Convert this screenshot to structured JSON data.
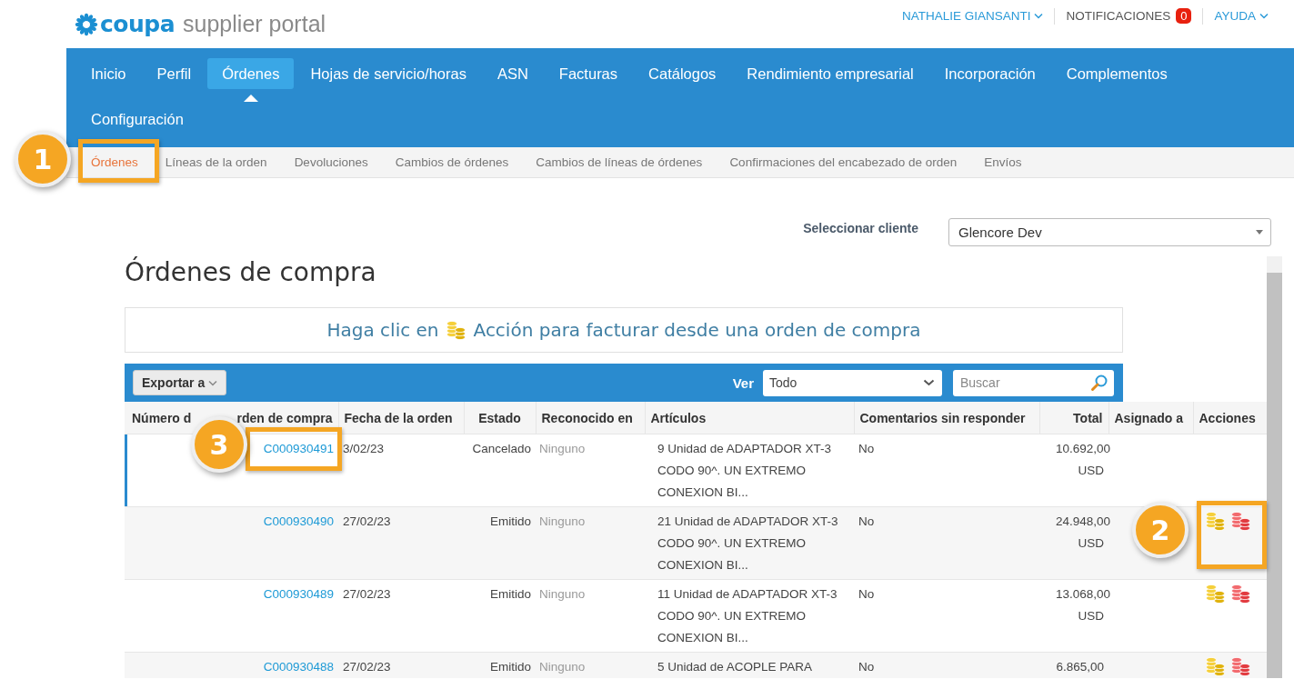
{
  "header": {
    "logo": {
      "brand": "coupa",
      "product": "supplier portal"
    },
    "user": "NATHALIE GIANSANTI",
    "notifications": {
      "label": "NOTIFICACIONES",
      "count": "0"
    },
    "help": "AYUDA"
  },
  "nav": {
    "items": [
      {
        "label": "Inicio",
        "selected": false
      },
      {
        "label": "Perfil",
        "selected": false
      },
      {
        "label": "Órdenes",
        "selected": true
      },
      {
        "label": "Hojas de servicio/horas",
        "selected": false
      },
      {
        "label": "ASN",
        "selected": false
      },
      {
        "label": "Facturas",
        "selected": false
      },
      {
        "label": "Catálogos",
        "selected": false
      },
      {
        "label": "Rendimiento empresarial",
        "selected": false
      },
      {
        "label": "Incorporación",
        "selected": false
      },
      {
        "label": "Complementos",
        "selected": false
      },
      {
        "label": "Configuración",
        "selected": false
      }
    ]
  },
  "subnav": {
    "items": [
      {
        "label": "Órdenes",
        "selected": true
      },
      {
        "label": "Líneas de la orden",
        "selected": false
      },
      {
        "label": "Devoluciones",
        "selected": false
      },
      {
        "label": "Cambios de órdenes",
        "selected": false
      },
      {
        "label": "Cambios de líneas de órdenes",
        "selected": false
      },
      {
        "label": "Confirmaciones del encabezado de orden",
        "selected": false
      },
      {
        "label": "Envíos",
        "selected": false
      }
    ]
  },
  "client_selector": {
    "label": "Seleccionar cliente",
    "value": "Glencore Dev"
  },
  "title": "Órdenes de compra",
  "banner": {
    "before": "Haga clic en",
    "after": "Acción para facturar desde una orden de compra"
  },
  "toolbar": {
    "export": "Exportar a",
    "view_label": "Ver",
    "view_value": "Todo",
    "search": {
      "placeholder": "Buscar"
    }
  },
  "table": {
    "columns": [
      {
        "label": "Número d",
        "label_after": "rden de compra"
      },
      {
        "label": "Fecha de la orden"
      },
      {
        "label": "Estado"
      },
      {
        "label": "Reconocido en"
      },
      {
        "label": "Artículos"
      },
      {
        "label": "Comentarios sin responder"
      },
      {
        "label": "Total"
      },
      {
        "label": "Asignado a"
      },
      {
        "label": "Acciones"
      }
    ],
    "rows": [
      {
        "selected": true,
        "number": "C000930491",
        "date": "3/02/23",
        "status": "Cancelado",
        "acknowledged": "Ninguno",
        "items": "9 Unidad de ADAPTADOR XT-3 CODO 90^. UN EXTREMO CONEXION BI...",
        "comments": "No",
        "total": "10.692,00 USD",
        "actions": []
      },
      {
        "selected": false,
        "number": "C000930490",
        "date": "27/02/23",
        "status": "Emitido",
        "acknowledged": "Ninguno",
        "items": "21 Unidad de ADAPTADOR XT-3 CODO 90^. UN EXTREMO CONEXION BI...",
        "comments": "No",
        "total": "24.948,00 USD",
        "actions": [
          {
            "kind": "invoice"
          },
          {
            "kind": "credit"
          }
        ]
      },
      {
        "selected": false,
        "number": "C000930489",
        "date": "27/02/23",
        "status": "Emitido",
        "acknowledged": "Ninguno",
        "items": "11 Unidad de ADAPTADOR XT-3 CODO 90^. UN EXTREMO CONEXION BI...",
        "comments": "No",
        "total": "13.068,00 USD",
        "actions": [
          {
            "kind": "invoice"
          },
          {
            "kind": "credit"
          }
        ]
      },
      {
        "selected": false,
        "number": "C000930488",
        "date": "27/02/23",
        "status": "Emitido",
        "acknowledged": "Ninguno",
        "items": "5 Unidad de ACOPLE PARA",
        "comments": "No",
        "total": "6.865,00",
        "actions": [
          {
            "kind": "invoice"
          },
          {
            "kind": "credit"
          }
        ]
      }
    ]
  },
  "annotations": [
    {
      "label": "1"
    },
    {
      "label": "2"
    },
    {
      "label": "3"
    }
  ]
}
